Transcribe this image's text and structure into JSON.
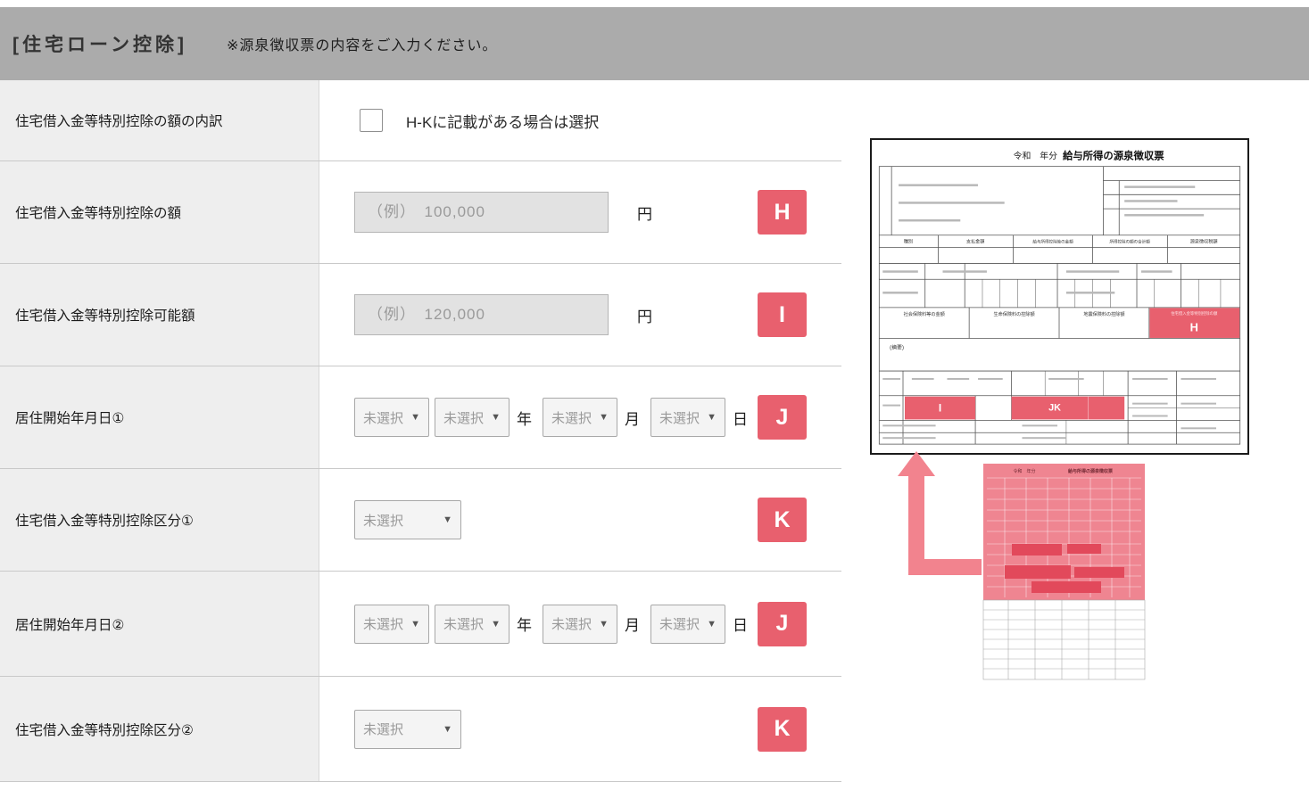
{
  "colors": {
    "accent_red": "#e8606e",
    "header_gray": "#ababab",
    "label_bg": "#eeeeee",
    "pink_overlay": "#ef8591"
  },
  "icons": {
    "chevron_down": "▼"
  },
  "header": {
    "title": "[住宅ローン控除]",
    "note": "※源泉徴収票の内容をご入力ください。"
  },
  "rows": [
    {
      "label": "住宅借入金等特別控除の額の内訳",
      "checkbox_label": "H-Kに記載がある場合は選択",
      "checked": false
    },
    {
      "label": "住宅借入金等特別控除の額",
      "placeholder": "（例）　100,000",
      "unit": "円",
      "badge": "H"
    },
    {
      "label": "住宅借入金等特別控除可能額",
      "placeholder": "（例）　120,000",
      "unit": "円",
      "badge": "I"
    },
    {
      "label": "居住開始年月日①",
      "select_value": "未選択",
      "year_unit": "年",
      "month_unit": "月",
      "day_unit": "日",
      "badge": "J"
    },
    {
      "label": "住宅借入金等特別控除区分①",
      "select_value": "未選択",
      "badge": "K"
    },
    {
      "label": "居住開始年月日②",
      "select_value": "未選択",
      "year_unit": "年",
      "month_unit": "月",
      "day_unit": "日",
      "badge": "J"
    },
    {
      "label": "住宅借入金等特別控除区分②",
      "select_value": "未選択",
      "badge": "K"
    }
  ],
  "slip": {
    "era_label": "令和　年分",
    "main_title": "給与所得の源泉徴収票",
    "payment_headers": [
      "種別",
      "支払金額",
      "給与所得控除後の金額",
      "所得控除の額の合計額",
      "源泉徴収税額"
    ],
    "deduction_headers": [
      "社会保険料等の金額",
      "生命保険料の控除額",
      "地震保険料の控除額",
      "住宅借入金等特別控除の額"
    ],
    "memo_label": "(摘要)",
    "markers": {
      "h": "H",
      "i": "I",
      "jk": "JK"
    }
  }
}
